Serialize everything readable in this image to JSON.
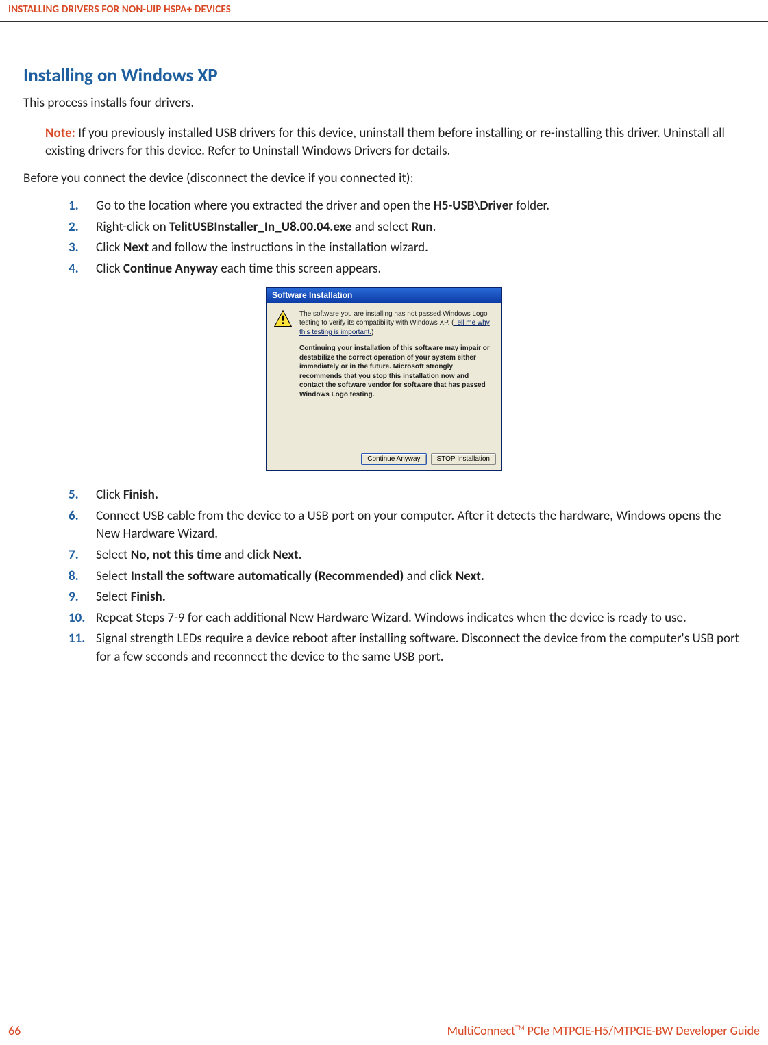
{
  "header": {
    "title": "INSTALLING DRIVERS FOR NON-UIP HSPA+ DEVICES"
  },
  "main": {
    "heading": "Installing on Windows XP",
    "intro": "This process installs four drivers.",
    "note": {
      "label": "Note:",
      "text": " If you previously installed USB drivers for this device, uninstall them before installing or re-installing this driver. Uninstall all existing drivers for this device. Refer to Uninstall Windows Drivers for details."
    },
    "before": "Before you connect the device (disconnect the device if you connected it):",
    "steps_top": [
      {
        "n": "1.",
        "pre": "Go to the location where you extracted the driver and open the ",
        "b": "H5-USB\\Driver",
        "post": " folder."
      },
      {
        "n": "2.",
        "pre": "Right-click on ",
        "b": "TelitUSBInstaller_In_U8.00.04.exe",
        "mid": " and select ",
        "b2": "Run",
        "post": "."
      },
      {
        "n": "3.",
        "pre": "Click ",
        "b": "Next",
        "post": " and follow the instructions in the installation wizard."
      },
      {
        "n": "4.",
        "pre": "Click ",
        "b": "Continue Anyway",
        "post": " each time this screen appears."
      }
    ],
    "steps_bottom": [
      {
        "n": "5.",
        "pre": "Click ",
        "b": "Finish.",
        "post": ""
      },
      {
        "n": "6.",
        "text": "Connect USB cable from the device to a USB port on your computer. After it detects the hardware, Windows opens the New Hardware Wizard."
      },
      {
        "n": "7.",
        "pre": "Select ",
        "b": "No, not this time",
        "mid": " and click ",
        "b2": "Next.",
        "post": ""
      },
      {
        "n": "8.",
        "pre": "Select ",
        "b": "Install the software automatically (Recommended)",
        "mid": " and click ",
        "b2": "Next.",
        "post": ""
      },
      {
        "n": "9.",
        "pre": "Select ",
        "b": "Finish.",
        "post": ""
      },
      {
        "n": "10.",
        "text": "Repeat Steps 7-9 for each additional New Hardware Wizard. Windows indicates when the device is ready to use."
      },
      {
        "n": "11.",
        "text": "Signal strength LEDs require a device reboot after installing software. Disconnect the device from the computer's USB port for a few seconds and reconnect the device to the same USB port."
      }
    ]
  },
  "dialog": {
    "title": "Software Installation",
    "p1a": "The software you are installing has not passed Windows Logo testing to verify its compatibility with Windows XP. (",
    "link": "Tell me why this testing is important.",
    "p1b": ")",
    "p2": "Continuing your installation of this software may impair or destabilize the correct operation of your system either immediately or in the future. Microsoft strongly recommends that you stop this installation now and contact the software vendor for software that has passed Windows Logo testing.",
    "btn_continue": "Continue Anyway",
    "btn_stop": "STOP Installation"
  },
  "footer": {
    "page": "66",
    "guide_pre": "MultiConnect",
    "guide_tm": "TM",
    "guide_post": " PCIe MTPCIE-H5/MTPCIE-BW Developer Guide"
  }
}
